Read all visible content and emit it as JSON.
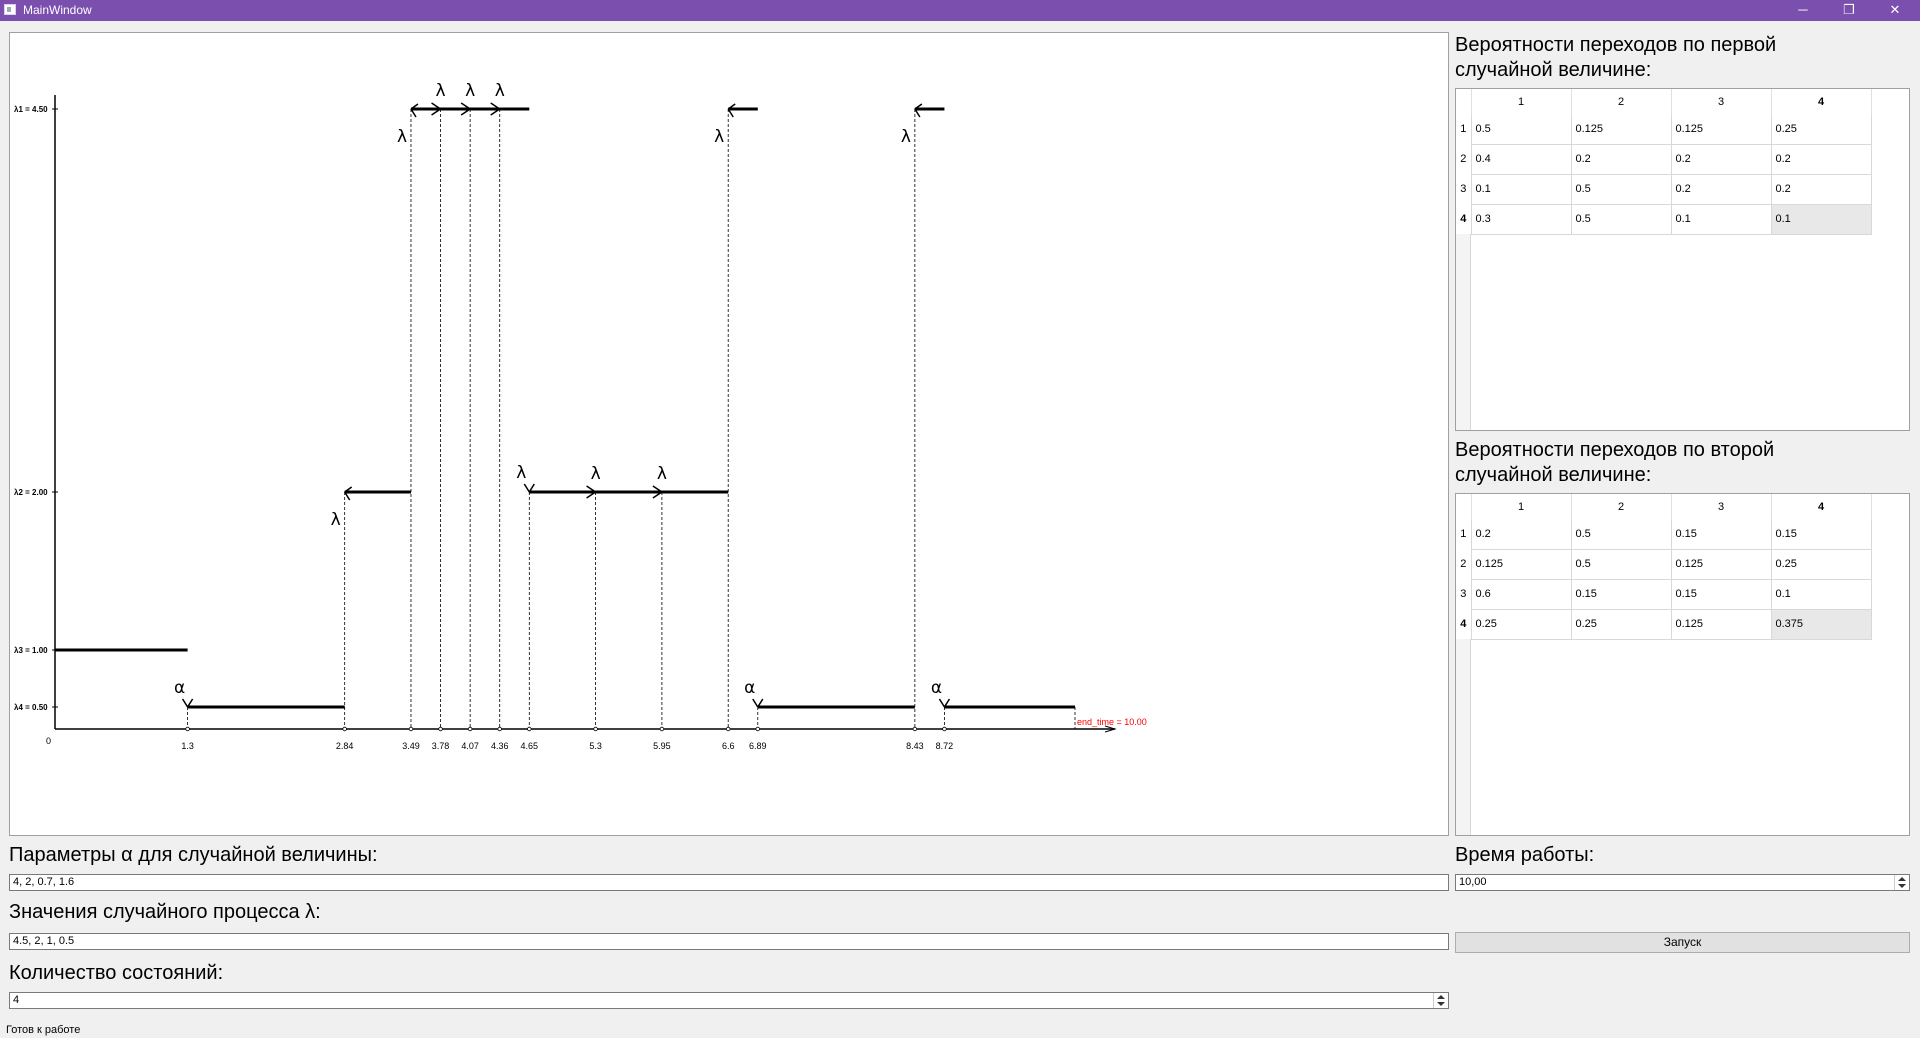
{
  "window": {
    "title": "MainWindow",
    "minimize": "─",
    "maximize": "❐",
    "close": "✕"
  },
  "chart_data": {
    "type": "line",
    "y_levels": [
      {
        "label": "λ1 = 4.50",
        "value": 4.5
      },
      {
        "label": "λ2 = 2.00",
        "value": 2.0
      },
      {
        "label": "λ3 = 1.00",
        "value": 1.0
      },
      {
        "label": "λ4 = 0.50",
        "value": 0.5
      }
    ],
    "origin_label": "0",
    "x_ticks": [
      {
        "value": 1.3,
        "label": "1.3"
      },
      {
        "value": 2.84,
        "label": "2.84"
      },
      {
        "value": 3.49,
        "label": "3.49"
      },
      {
        "value": 3.78,
        "label": "3.78"
      },
      {
        "value": 4.07,
        "label": "4.07"
      },
      {
        "value": 4.36,
        "label": "4.36"
      },
      {
        "value": 4.65,
        "label": "4.65"
      },
      {
        "value": 5.3,
        "label": "5.3"
      },
      {
        "value": 5.95,
        "label": "5.95"
      },
      {
        "value": 6.6,
        "label": "6.6"
      },
      {
        "value": 6.89,
        "label": "6.89"
      },
      {
        "value": 8.43,
        "label": "8.43"
      },
      {
        "value": 8.72,
        "label": "8.72"
      }
    ],
    "segments": [
      {
        "x0": 0,
        "x1": 1.3,
        "y": 1.0
      },
      {
        "x0": 1.3,
        "x1": 2.84,
        "y": 0.5
      },
      {
        "x0": 2.84,
        "x1": 3.49,
        "y": 2.0
      },
      {
        "x0": 3.49,
        "x1": 4.65,
        "y": 4.5
      },
      {
        "x0": 4.65,
        "x1": 6.6,
        "y": 2.0
      },
      {
        "x0": 6.6,
        "x1": 6.89,
        "y": 4.5
      },
      {
        "x0": 6.89,
        "x1": 8.43,
        "y": 0.5
      },
      {
        "x0": 8.43,
        "x1": 8.72,
        "y": 4.5
      },
      {
        "x0": 8.72,
        "x1": 10.0,
        "y": 0.5
      }
    ],
    "events": [
      {
        "x": 1.3,
        "y": 0.5,
        "kind": "down",
        "symbol": "α"
      },
      {
        "x": 2.84,
        "y": 2.0,
        "kind": "up",
        "symbol": "λ"
      },
      {
        "x": 3.49,
        "y": 4.5,
        "kind": "up",
        "symbol": "λ"
      },
      {
        "x": 3.78,
        "y": 4.5,
        "kind": "right",
        "symbol": "λ"
      },
      {
        "x": 4.07,
        "y": 4.5,
        "kind": "right",
        "symbol": "λ"
      },
      {
        "x": 4.36,
        "y": 4.5,
        "kind": "right",
        "symbol": "λ"
      },
      {
        "x": 4.65,
        "y": 2.0,
        "kind": "down",
        "symbol": "λ"
      },
      {
        "x": 5.3,
        "y": 2.0,
        "kind": "right",
        "symbol": "λ"
      },
      {
        "x": 5.95,
        "y": 2.0,
        "kind": "right",
        "symbol": "λ"
      },
      {
        "x": 6.6,
        "y": 4.5,
        "kind": "up",
        "symbol": "λ"
      },
      {
        "x": 6.89,
        "y": 0.5,
        "kind": "down",
        "symbol": "α"
      },
      {
        "x": 8.43,
        "y": 4.5,
        "kind": "up",
        "symbol": "λ"
      },
      {
        "x": 8.72,
        "y": 0.5,
        "kind": "down",
        "symbol": "α"
      }
    ],
    "end_label": "end_time = 10.00",
    "end_time": 10.0,
    "end_label_color": "#ff0000"
  },
  "table1": {
    "title": "Вероятности переходов по первой случайной величине:",
    "col_headers": [
      "1",
      "2",
      "3",
      "4"
    ],
    "row_headers": [
      "1",
      "2",
      "3",
      "4"
    ],
    "rows": [
      [
        "0.5",
        "0.125",
        "0.125",
        "0.25"
      ],
      [
        "0.4",
        "0.2",
        "0.2",
        "0.2"
      ],
      [
        "0.1",
        "0.5",
        "0.2",
        "0.2"
      ],
      [
        "0.3",
        "0.5",
        "0.1",
        "0.1"
      ]
    ]
  },
  "table2": {
    "title": "Вероятности переходов по второй случайной величине:",
    "col_headers": [
      "1",
      "2",
      "3",
      "4"
    ],
    "row_headers": [
      "1",
      "2",
      "3",
      "4"
    ],
    "rows": [
      [
        "0.2",
        "0.5",
        "0.15",
        "0.15"
      ],
      [
        "0.125",
        "0.5",
        "0.125",
        "0.25"
      ],
      [
        "0.6",
        "0.15",
        "0.15",
        "0.1"
      ],
      [
        "0.25",
        "0.25",
        "0.125",
        "0.375"
      ]
    ]
  },
  "form": {
    "alpha_label": "Параметры α для случайной величины:",
    "alpha_value": "4, 2, 0.7, 1.6",
    "lambda_label": "Значения случайного процесса λ:",
    "lambda_value": "4.5, 2, 1, 0.5",
    "states_label": "Количество состояний:",
    "states_value": "4",
    "time_label": "Время работы:",
    "time_value": "10,00",
    "run_button": "Запуск"
  },
  "status": "Готов к работе"
}
